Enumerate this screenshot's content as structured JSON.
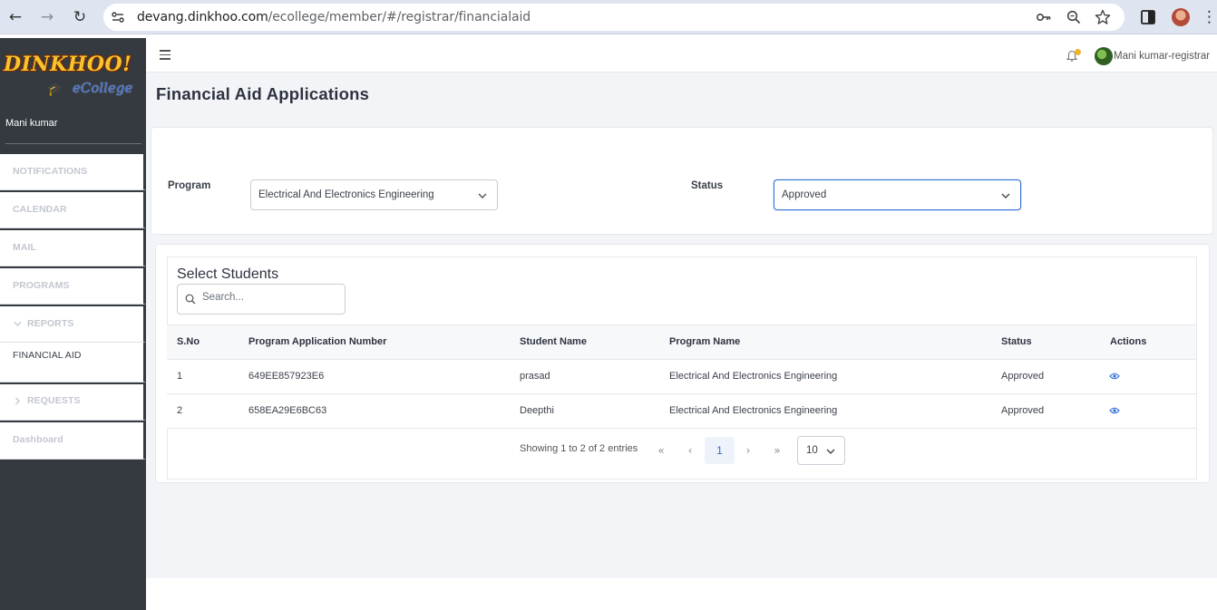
{
  "browser": {
    "url_host": "devang.dinkhoo.com",
    "url_path": "/ecollege/member/#/registrar/financialaid"
  },
  "brand": {
    "logo_top": "DINKHOO!",
    "logo_bottom": "eCollege"
  },
  "sidebar": {
    "user_name": "Mani kumar",
    "items": [
      {
        "label": "NOTIFICATIONS"
      },
      {
        "label": "CALENDAR"
      },
      {
        "label": "MAIL"
      },
      {
        "label": "PROGRAMS"
      },
      {
        "label": "REPORTS",
        "icon": "chevron-down-icon"
      },
      {
        "label": "FINANCIAL AID"
      },
      {
        "label": "REQUESTS",
        "icon": "chevron-right-icon"
      },
      {
        "label": "Dashboard"
      }
    ]
  },
  "header": {
    "user_role": "Mani kumar-registrar"
  },
  "page": {
    "title": "Financial Aid Applications"
  },
  "filters": {
    "program_label": "Program",
    "program_value": "Electrical And Electronics Engineering",
    "status_label": "Status",
    "status_value": "Approved"
  },
  "students": {
    "title": "Select Students",
    "search_placeholder": "Search...",
    "columns": [
      "S.No",
      "Program Application Number",
      "Student Name",
      "Program Name",
      "Status",
      "Actions"
    ],
    "rows": [
      {
        "sno": "1",
        "app_number": "649EE857923E6",
        "name": "prasad",
        "program": "Electrical And Electronics Engineering",
        "status": "Approved"
      },
      {
        "sno": "2",
        "app_number": "658EA29E6BC63",
        "name": "Deepthi",
        "program": "Electrical And Electronics Engineering",
        "status": "Approved"
      }
    ]
  },
  "pagination": {
    "showing": "Showing 1 to 2 of 2 entries",
    "first": "«",
    "prev": "‹",
    "current_page": "1",
    "next": "›",
    "last": "»",
    "page_size": "10"
  },
  "colors": {
    "sidebar_bg": "#343a40",
    "accent": "#2f6fd6",
    "notification_dot": "#f0b429"
  }
}
